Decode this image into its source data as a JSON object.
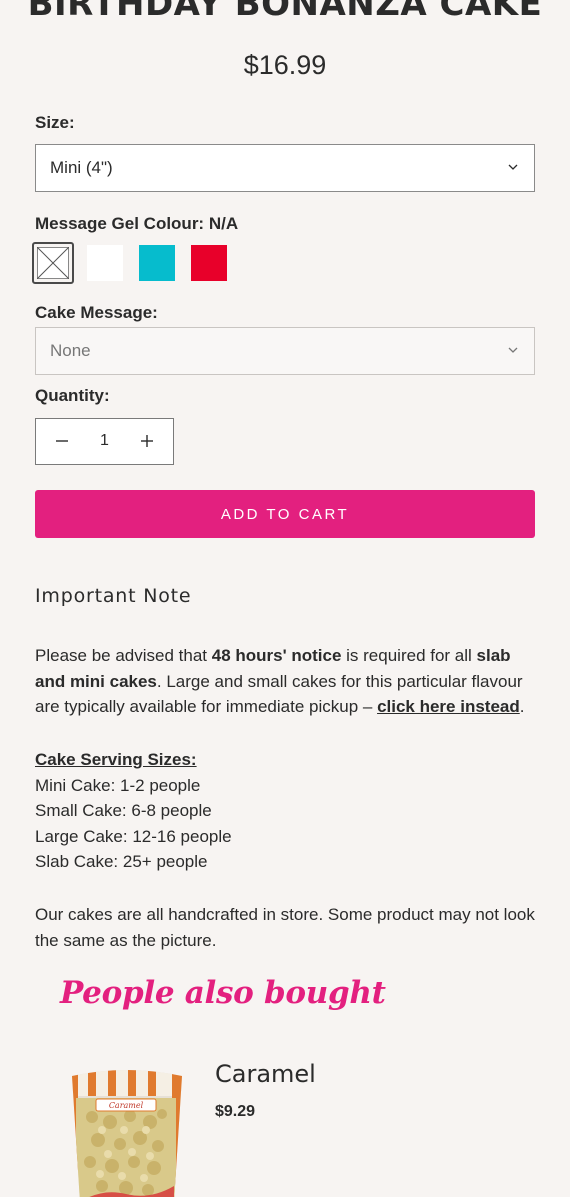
{
  "product": {
    "title": "BIRTHDAY BONANZA CAKE",
    "price": "$16.99"
  },
  "size": {
    "label": "Size:",
    "selected": "Mini (4\")",
    "icon": "chevron-down-icon"
  },
  "gel": {
    "label": "Message Gel Colour: N/A",
    "swatches": [
      {
        "name": "N/A",
        "color": "#ffffff",
        "selected": true
      },
      {
        "name": "White",
        "color": "#ffffff",
        "selected": false
      },
      {
        "name": "Blue",
        "color": "#06bccd",
        "selected": false
      },
      {
        "name": "Red",
        "color": "#e8002a",
        "selected": false
      }
    ]
  },
  "message": {
    "label": "Cake Message:",
    "selected": "None",
    "icon": "chevron-down-icon"
  },
  "quantity": {
    "label": "Quantity:",
    "value": "1",
    "minus_icon": "minus-icon",
    "plus_icon": "plus-icon"
  },
  "cart": {
    "add_label": "ADD TO CART",
    "color": "#e3207f"
  },
  "note": {
    "heading": "Important Note",
    "p1_a": "Please be advised that ",
    "p1_b": "48 hours' notice",
    "p1_c": " is required for all ",
    "p1_d": "slab and mini cakes",
    "p1_e": ". Large and small cakes for this particular flavour are typically available for immediate pickup – ",
    "p1_link": "click here instead",
    "p1_f": ".",
    "sizes_heading": "Cake Serving Sizes:",
    "sizes": [
      "Mini Cake: 1-2 people",
      "Small Cake: 6-8 people",
      "Large Cake: 12-16 people",
      "Slab Cake: 25+ people"
    ],
    "p3": "Our cakes are all handcrafted in store. Some product may not look the same as the picture."
  },
  "also_bought": {
    "heading": "People also bought",
    "items": [
      {
        "name": "Caramel",
        "price": "$9.29",
        "package_label": "Caramel"
      }
    ]
  }
}
